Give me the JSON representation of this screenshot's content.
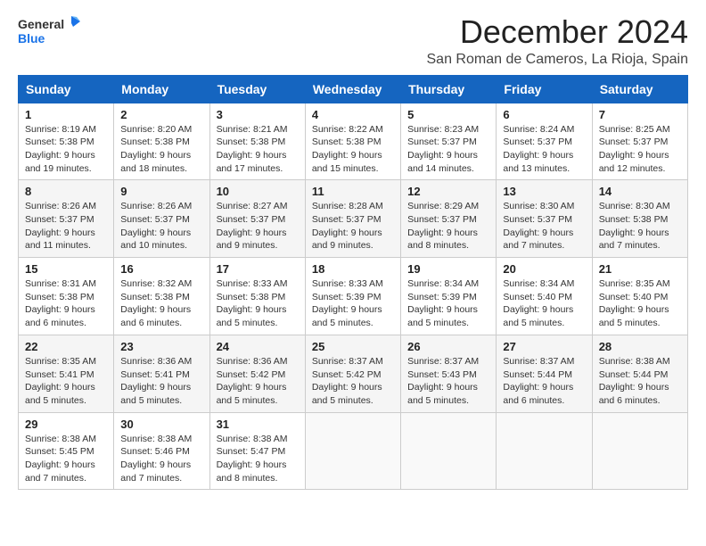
{
  "logo": {
    "line1": "General",
    "line2": "Blue"
  },
  "title": "December 2024",
  "location": "San Roman de Cameros, La Rioja, Spain",
  "days_header": [
    "Sunday",
    "Monday",
    "Tuesday",
    "Wednesday",
    "Thursday",
    "Friday",
    "Saturday"
  ],
  "weeks": [
    [
      {
        "day": "1",
        "info": "Sunrise: 8:19 AM\nSunset: 5:38 PM\nDaylight: 9 hours\nand 19 minutes."
      },
      {
        "day": "2",
        "info": "Sunrise: 8:20 AM\nSunset: 5:38 PM\nDaylight: 9 hours\nand 18 minutes."
      },
      {
        "day": "3",
        "info": "Sunrise: 8:21 AM\nSunset: 5:38 PM\nDaylight: 9 hours\nand 17 minutes."
      },
      {
        "day": "4",
        "info": "Sunrise: 8:22 AM\nSunset: 5:38 PM\nDaylight: 9 hours\nand 15 minutes."
      },
      {
        "day": "5",
        "info": "Sunrise: 8:23 AM\nSunset: 5:37 PM\nDaylight: 9 hours\nand 14 minutes."
      },
      {
        "day": "6",
        "info": "Sunrise: 8:24 AM\nSunset: 5:37 PM\nDaylight: 9 hours\nand 13 minutes."
      },
      {
        "day": "7",
        "info": "Sunrise: 8:25 AM\nSunset: 5:37 PM\nDaylight: 9 hours\nand 12 minutes."
      }
    ],
    [
      {
        "day": "8",
        "info": "Sunrise: 8:26 AM\nSunset: 5:37 PM\nDaylight: 9 hours\nand 11 minutes."
      },
      {
        "day": "9",
        "info": "Sunrise: 8:26 AM\nSunset: 5:37 PM\nDaylight: 9 hours\nand 10 minutes."
      },
      {
        "day": "10",
        "info": "Sunrise: 8:27 AM\nSunset: 5:37 PM\nDaylight: 9 hours\nand 9 minutes."
      },
      {
        "day": "11",
        "info": "Sunrise: 8:28 AM\nSunset: 5:37 PM\nDaylight: 9 hours\nand 9 minutes."
      },
      {
        "day": "12",
        "info": "Sunrise: 8:29 AM\nSunset: 5:37 PM\nDaylight: 9 hours\nand 8 minutes."
      },
      {
        "day": "13",
        "info": "Sunrise: 8:30 AM\nSunset: 5:37 PM\nDaylight: 9 hours\nand 7 minutes."
      },
      {
        "day": "14",
        "info": "Sunrise: 8:30 AM\nSunset: 5:38 PM\nDaylight: 9 hours\nand 7 minutes."
      }
    ],
    [
      {
        "day": "15",
        "info": "Sunrise: 8:31 AM\nSunset: 5:38 PM\nDaylight: 9 hours\nand 6 minutes."
      },
      {
        "day": "16",
        "info": "Sunrise: 8:32 AM\nSunset: 5:38 PM\nDaylight: 9 hours\nand 6 minutes."
      },
      {
        "day": "17",
        "info": "Sunrise: 8:33 AM\nSunset: 5:38 PM\nDaylight: 9 hours\nand 5 minutes."
      },
      {
        "day": "18",
        "info": "Sunrise: 8:33 AM\nSunset: 5:39 PM\nDaylight: 9 hours\nand 5 minutes."
      },
      {
        "day": "19",
        "info": "Sunrise: 8:34 AM\nSunset: 5:39 PM\nDaylight: 9 hours\nand 5 minutes."
      },
      {
        "day": "20",
        "info": "Sunrise: 8:34 AM\nSunset: 5:40 PM\nDaylight: 9 hours\nand 5 minutes."
      },
      {
        "day": "21",
        "info": "Sunrise: 8:35 AM\nSunset: 5:40 PM\nDaylight: 9 hours\nand 5 minutes."
      }
    ],
    [
      {
        "day": "22",
        "info": "Sunrise: 8:35 AM\nSunset: 5:41 PM\nDaylight: 9 hours\nand 5 minutes."
      },
      {
        "day": "23",
        "info": "Sunrise: 8:36 AM\nSunset: 5:41 PM\nDaylight: 9 hours\nand 5 minutes."
      },
      {
        "day": "24",
        "info": "Sunrise: 8:36 AM\nSunset: 5:42 PM\nDaylight: 9 hours\nand 5 minutes."
      },
      {
        "day": "25",
        "info": "Sunrise: 8:37 AM\nSunset: 5:42 PM\nDaylight: 9 hours\nand 5 minutes."
      },
      {
        "day": "26",
        "info": "Sunrise: 8:37 AM\nSunset: 5:43 PM\nDaylight: 9 hours\nand 5 minutes."
      },
      {
        "day": "27",
        "info": "Sunrise: 8:37 AM\nSunset: 5:44 PM\nDaylight: 9 hours\nand 6 minutes."
      },
      {
        "day": "28",
        "info": "Sunrise: 8:38 AM\nSunset: 5:44 PM\nDaylight: 9 hours\nand 6 minutes."
      }
    ],
    [
      {
        "day": "29",
        "info": "Sunrise: 8:38 AM\nSunset: 5:45 PM\nDaylight: 9 hours\nand 7 minutes."
      },
      {
        "day": "30",
        "info": "Sunrise: 8:38 AM\nSunset: 5:46 PM\nDaylight: 9 hours\nand 7 minutes."
      },
      {
        "day": "31",
        "info": "Sunrise: 8:38 AM\nSunset: 5:47 PM\nDaylight: 9 hours\nand 8 minutes."
      },
      {
        "day": "",
        "info": ""
      },
      {
        "day": "",
        "info": ""
      },
      {
        "day": "",
        "info": ""
      },
      {
        "day": "",
        "info": ""
      }
    ]
  ]
}
